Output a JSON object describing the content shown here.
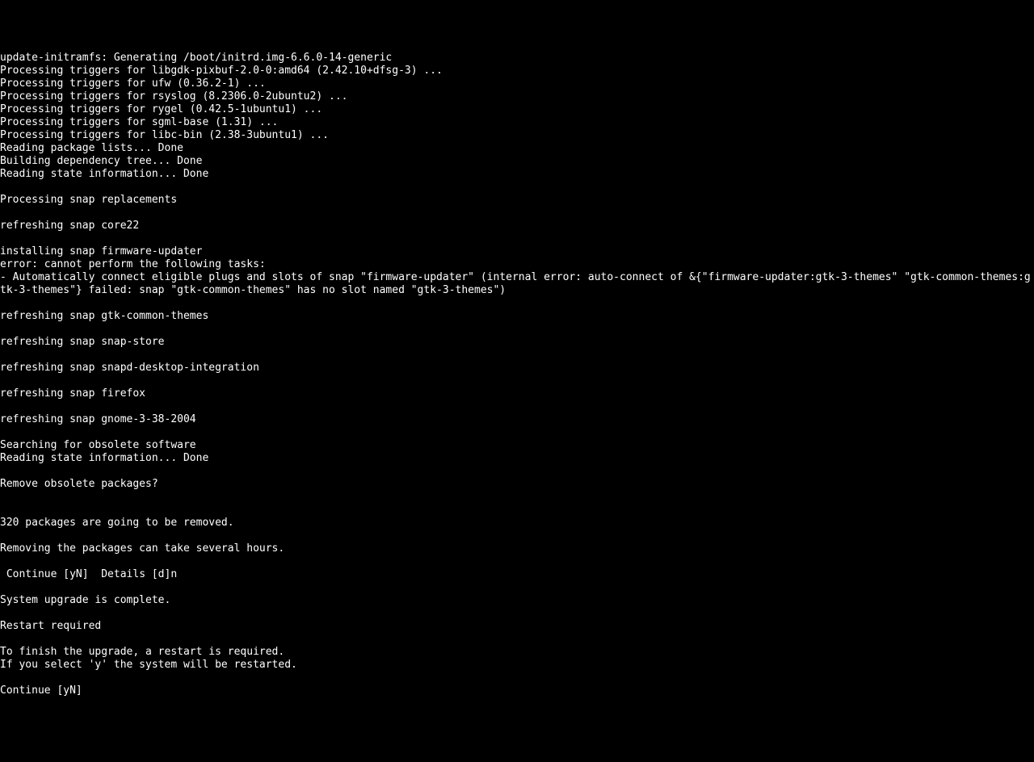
{
  "terminal": {
    "lines": [
      "update-initramfs: Generating /boot/initrd.img-6.6.0-14-generic",
      "Processing triggers for libgdk-pixbuf-2.0-0:amd64 (2.42.10+dfsg-3) ...",
      "Processing triggers for ufw (0.36.2-1) ...",
      "Processing triggers for rsyslog (8.2306.0-2ubuntu2) ...",
      "Processing triggers for rygel (0.42.5-1ubuntu1) ...",
      "Processing triggers for sgml-base (1.31) ...",
      "Processing triggers for libc-bin (2.38-3ubuntu1) ...",
      "Reading package lists... Done",
      "Building dependency tree... Done",
      "Reading state information... Done",
      "",
      "Processing snap replacements",
      "",
      "refreshing snap core22",
      "",
      "installing snap firmware-updater",
      "error: cannot perform the following tasks:",
      "- Automatically connect eligible plugs and slots of snap \"firmware-updater\" (internal error: auto-connect of &{\"firmware-updater:gtk-3-themes\" \"gtk-common-themes:gtk-3-themes\"} failed: snap \"gtk-common-themes\" has no slot named \"gtk-3-themes\")",
      "",
      "refreshing snap gtk-common-themes",
      "",
      "refreshing snap snap-store",
      "",
      "refreshing snap snapd-desktop-integration",
      "",
      "refreshing snap firefox",
      "",
      "refreshing snap gnome-3-38-2004",
      "",
      "Searching for obsolete software",
      "Reading state information... Done",
      "",
      "Remove obsolete packages?",
      "",
      "",
      "320 packages are going to be removed.",
      "",
      "Removing the packages can take several hours.",
      "",
      " Continue [yN]  Details [d]n",
      "",
      "System upgrade is complete.",
      "",
      "Restart required",
      "",
      "To finish the upgrade, a restart is required.",
      "If you select 'y' the system will be restarted.",
      "",
      "Continue [yN]"
    ]
  }
}
